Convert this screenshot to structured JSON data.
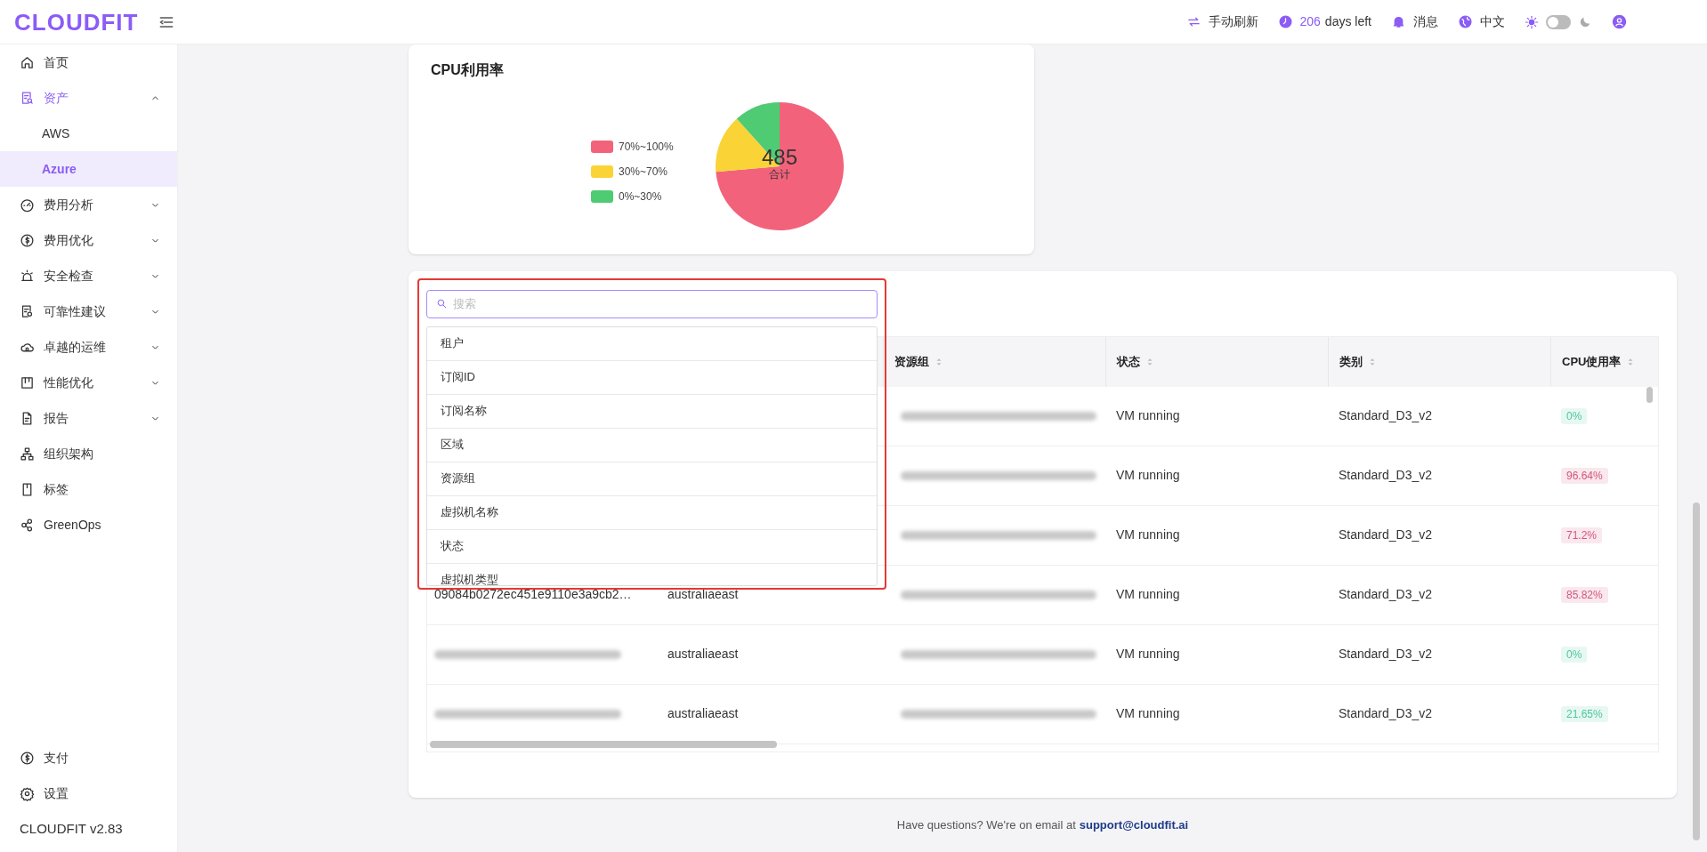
{
  "header": {
    "logo": "CLOUDFIT",
    "refresh": "手动刷新",
    "days_count": "206",
    "days_label": "days left",
    "messages": "消息",
    "language": "中文",
    "dark_mode": false
  },
  "sidebar": {
    "items": [
      {
        "kind": "link",
        "label": "首页",
        "selected": false
      },
      {
        "kind": "group",
        "label": "资产",
        "selected": false,
        "expanded": true,
        "children": [
          {
            "label": "AWS",
            "selected": false
          },
          {
            "label": "Azure",
            "selected": true
          }
        ]
      },
      {
        "kind": "group",
        "label": "费用分析",
        "selected": false,
        "expanded": false
      },
      {
        "kind": "group",
        "label": "费用优化",
        "selected": false,
        "expanded": false
      },
      {
        "kind": "group",
        "label": "安全检查",
        "selected": false,
        "expanded": false
      },
      {
        "kind": "group",
        "label": "可靠性建议",
        "selected": false,
        "expanded": false
      },
      {
        "kind": "group",
        "label": "卓越的运维",
        "selected": false,
        "expanded": false
      },
      {
        "kind": "group",
        "label": "性能优化",
        "selected": false,
        "expanded": false
      },
      {
        "kind": "group",
        "label": "报告",
        "selected": false,
        "expanded": false
      },
      {
        "kind": "link",
        "label": "组织架构",
        "selected": false
      },
      {
        "kind": "link",
        "label": "标签",
        "selected": false
      },
      {
        "kind": "link",
        "label": "GreenOps",
        "selected": false
      }
    ],
    "bottom_items": [
      {
        "label": "支付",
        "selected": false
      },
      {
        "label": "设置",
        "selected": false
      }
    ],
    "version": "CLOUDFIT v2.83"
  },
  "cpu_card": {
    "title": "CPU利用率",
    "total": "485",
    "total_label": "合计",
    "legend": [
      {
        "label": "70%~100%",
        "color": "#f2637b"
      },
      {
        "label": "30%~70%",
        "color": "#fad337"
      },
      {
        "label": "0%~30%",
        "color": "#4ecb73"
      }
    ]
  },
  "column_picker": {
    "placeholder": "搜索",
    "options": [
      "租户",
      "订阅ID",
      "订阅名称",
      "区域",
      "资源组",
      "虚拟机名称",
      "状态",
      "虚拟机类型"
    ]
  },
  "table": {
    "columns": [
      {
        "label": "资源组"
      },
      {
        "label": "状态"
      },
      {
        "label": "类别"
      },
      {
        "label": "CPU使用率"
      }
    ],
    "rows": [
      {
        "resource_group_redacted": true,
        "status": "VM running",
        "type": "Standard_D3_v2",
        "cpu": "0%",
        "color": "#4cc79a"
      },
      {
        "resource_group_redacted": true,
        "status": "VM running",
        "type": "Standard_D3_v2",
        "cpu": "96.64%",
        "color": "#d4567c"
      },
      {
        "resource_group_redacted": true,
        "status": "VM running",
        "type": "Standard_D3_v2",
        "cpu": "71.2%",
        "color": "#d4567c"
      },
      {
        "id": "09084b0272ec451e9110e3a9cb2…",
        "id_redacted": false,
        "region": "australiaeast",
        "resource_group_redacted": true,
        "status": "VM running",
        "type": "Standard_D3_v2",
        "cpu": "85.82%",
        "color": "#d4567c"
      },
      {
        "id_redacted": true,
        "region": "australiaeast",
        "resource_group_redacted": true,
        "status": "VM running",
        "type": "Standard_D3_v2",
        "cpu": "0%",
        "color": "#4cc79a"
      },
      {
        "id_redacted": true,
        "region": "australiaeast",
        "resource_group_redacted": true,
        "status": "VM running",
        "type": "Standard_D3_v2",
        "cpu": "21.65%",
        "color": "#4cc79a"
      }
    ]
  },
  "footer": {
    "text": "Have questions? We're on email at",
    "email": "support@cloudfit.ai"
  }
}
